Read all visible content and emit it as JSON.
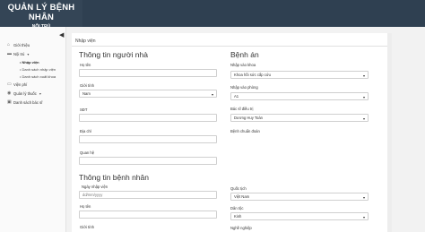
{
  "app": {
    "title": "QUẢN LÝ BỆNH NHÂN",
    "subtitle": "NỘI TRÚ"
  },
  "sidebar": {
    "items": [
      {
        "label": "Giới thiệu",
        "icon": "home-icon"
      },
      {
        "label": "Nội trú",
        "icon": "bed-icon"
      },
      {
        "label": "Viện phí",
        "icon": "money-icon"
      },
      {
        "label": "Quản lý thuốc",
        "icon": "pill-icon"
      },
      {
        "label": "Danh sách bác sĩ",
        "icon": "doctor-icon"
      }
    ],
    "subitems": [
      "• Nhập viện",
      "• Danh sách nhập viện",
      "• Danh sách xuất khoa"
    ]
  },
  "main": {
    "page_label": "Nhập viện"
  },
  "relative": {
    "title": "Thông tin người nhà",
    "name_label": "Họ tên",
    "gender_label": "Giới tính",
    "gender_value": "Nam",
    "phone_label": "SĐT",
    "address_label": "Địa chỉ",
    "relation_label": "Quan hệ"
  },
  "record": {
    "title": "Bệnh án",
    "dept_label": "Nhập vào khoa",
    "dept_value": "Khoa hồi sức cấp cứu",
    "room_label": "Nhập vào phòng",
    "room_value": "A1",
    "doctor_label": "Bác sĩ điều trị",
    "doctor_value": "Dương Huy Toàn",
    "diagnosis_label": "Bệnh chuẩn đoán"
  },
  "patient": {
    "title": "Thông tin bệnh nhân",
    "date_label": "Ngày nhập viện",
    "date_placeholder": "dd/mm/yyyy",
    "name_label": "Họ tên",
    "gender_label": "Giới tính",
    "nationality_label": "Quốc tịch",
    "nationality_value": "Việt Nam",
    "ethnicity_label": "Dân tộc",
    "ethnicity_value": "Kinh",
    "job_label": "Nghề nghiệp"
  }
}
